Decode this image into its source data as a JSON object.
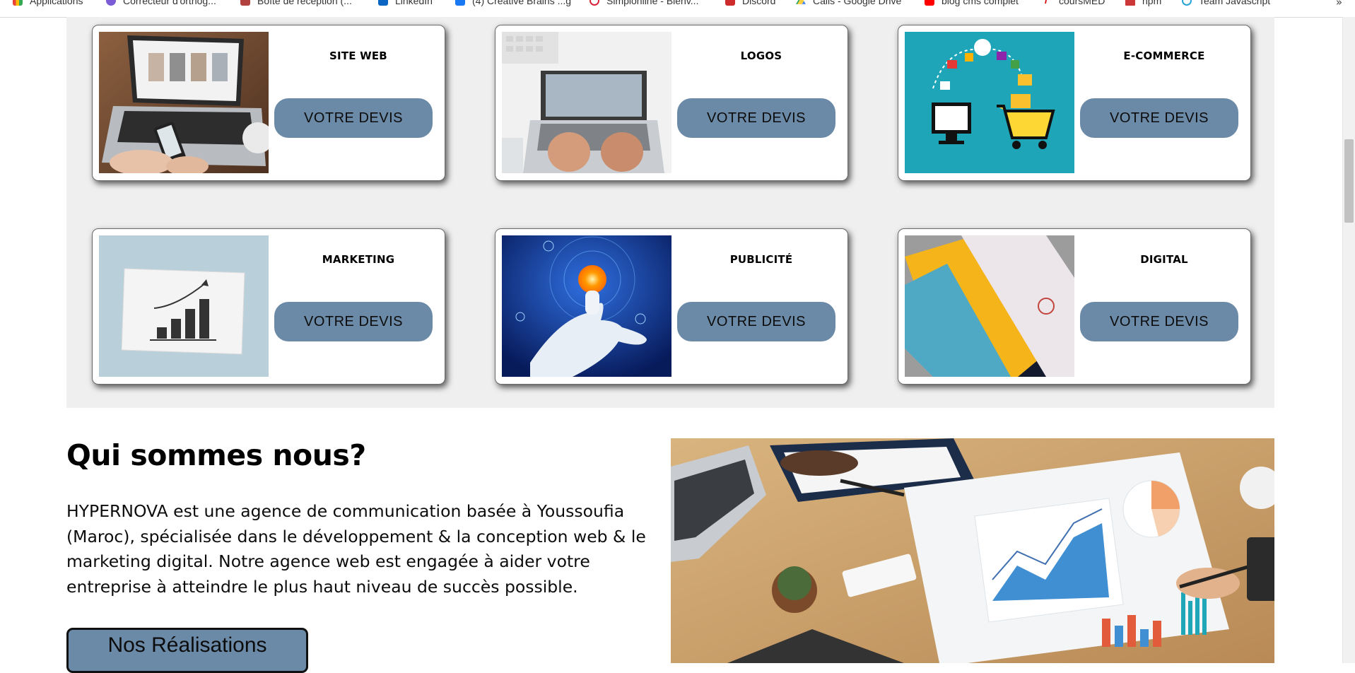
{
  "bookmarks": {
    "items": [
      {
        "label": "Applications",
        "icon": "apps-grid-icon",
        "color": "#4285f4"
      },
      {
        "label": "Correcteur d'orthog...",
        "icon": "spellcheck-icon",
        "color": "#7b5cd6"
      },
      {
        "label": "Boîte de réception (...",
        "icon": "mail-icon",
        "color": "#b0413e"
      },
      {
        "label": "LinkedIn",
        "icon": "linkedin-icon",
        "color": "#0a66c2"
      },
      {
        "label": "(4) Creative Brains ...g",
        "icon": "facebook-icon",
        "color": "#1877f2"
      },
      {
        "label": "Simplonline - Bienv...",
        "icon": "simplon-icon",
        "color": "#d6243b"
      },
      {
        "label": "Discord",
        "icon": "discord-icon",
        "color": "#ce2c2c"
      },
      {
        "label": "Calls - Google Drive",
        "icon": "google-drive-icon",
        "color": "#1fa463"
      },
      {
        "label": "blog cms complet",
        "icon": "youtube-icon",
        "color": "#ff0000"
      },
      {
        "label": "coursMED",
        "icon": "slash-icon",
        "color": "#d00000"
      },
      {
        "label": "npm",
        "icon": "npm-icon",
        "color": "#cb3837"
      },
      {
        "label": "Team Javascript",
        "icon": "team-icon",
        "color": "#29a3d4"
      }
    ],
    "more": "»"
  },
  "services": {
    "cards": [
      {
        "title": "SITE WEB",
        "button": "VOTRE DEVIS",
        "image": "laptop-website-image"
      },
      {
        "title": "LOGOS",
        "button": "VOTRE DEVIS",
        "image": "typing-laptop-image"
      },
      {
        "title": "E-COMMERCE",
        "button": "VOTRE DEVIS",
        "image": "ecommerce-illustration-image"
      },
      {
        "title": "MARKETING",
        "button": "VOTRE DEVIS",
        "image": "growth-chart-image"
      },
      {
        "title": "PUBLICITÉ",
        "button": "VOTRE DEVIS",
        "image": "robot-hand-cart-image"
      },
      {
        "title": "DIGITAL",
        "button": "VOTRE DEVIS",
        "image": "business-cards-image"
      }
    ]
  },
  "about": {
    "title": "Qui sommes nous?",
    "text": "HYPERNOVA est une agence de communication basée à Youssoufia (Maroc), spécialisée dans le développement & la conception web & le marketing digital. Notre agence web est engagée à aider votre entreprise à atteindre le plus haut niveau de succès possible.",
    "button": "Nos Réalisations",
    "image": "business-analytics-desk-image"
  },
  "colors": {
    "button_bg": "#6b8aa7",
    "section_bg": "#efefef"
  }
}
